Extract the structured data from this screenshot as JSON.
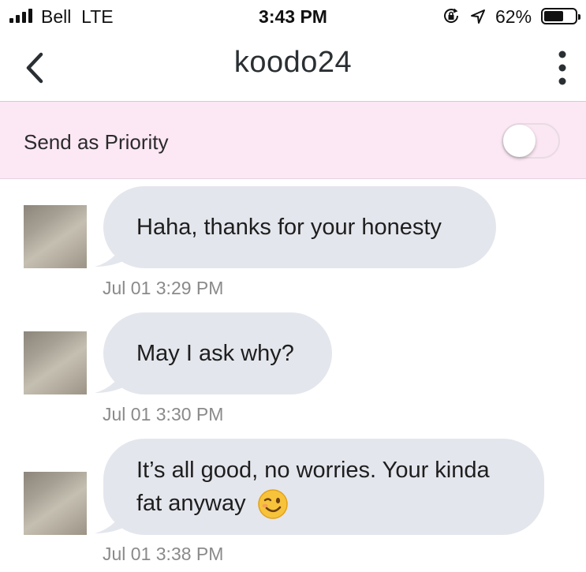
{
  "status_bar": {
    "carrier": "Bell",
    "network": "LTE",
    "time": "3:43 PM",
    "battery_percent": "62%",
    "battery_level": 0.62,
    "icons": [
      "signal-icon",
      "orientation-lock-icon",
      "location-icon",
      "battery-icon"
    ]
  },
  "nav": {
    "title": "koodo24",
    "back_icon": "chevron-left-icon",
    "more_icon": "more-vertical-icon"
  },
  "priority": {
    "label": "Send as Priority",
    "toggle_on": false
  },
  "messages": [
    {
      "text": "Haha, thanks for your honesty",
      "timestamp": "Jul 01 3:29 PM"
    },
    {
      "text": "May I ask why?",
      "timestamp": "Jul 01 3:30 PM"
    },
    {
      "text_line1": "It’s all good, no worries. Your kinda",
      "text_line2": "fat anyway",
      "emoji": "winking-face-emoji",
      "timestamp": "Jul 01 3:38 PM"
    }
  ],
  "colors": {
    "priority_bg": "#fce7f4",
    "bubble_bg": "#e4e6ed",
    "timestamp": "#8a8a8a"
  }
}
